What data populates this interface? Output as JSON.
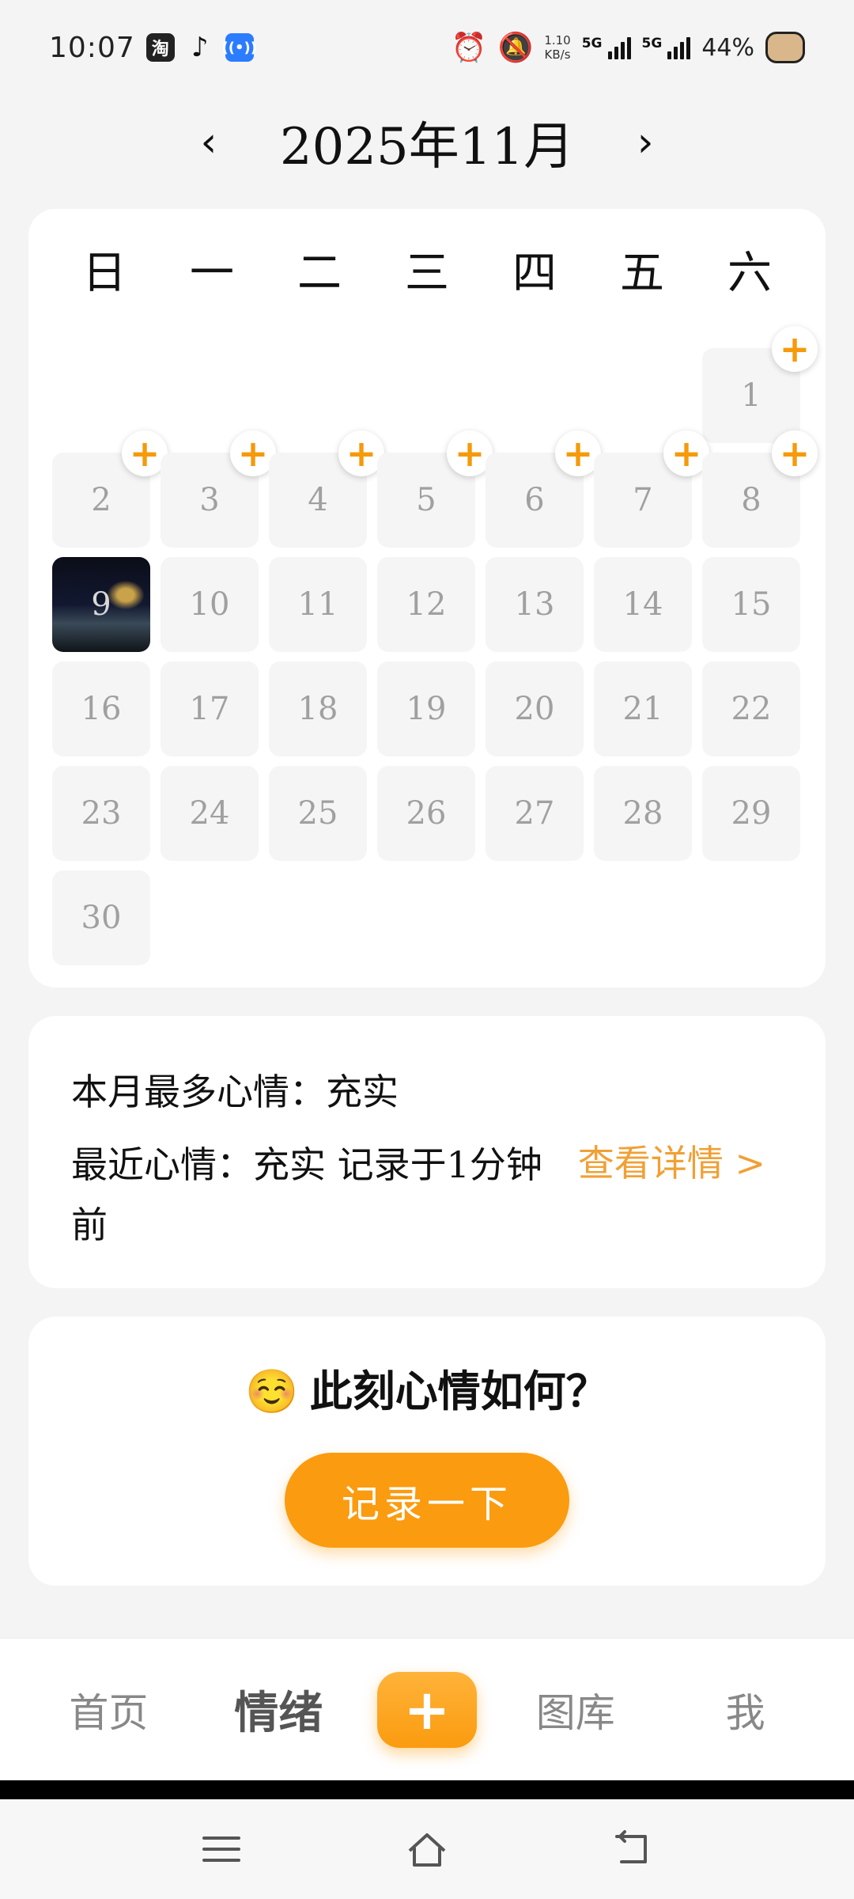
{
  "status_bar": {
    "time": "10:07",
    "app_icons": [
      "taobao-icon",
      "tiktok-icon",
      "radio-icon"
    ],
    "taobao_glyph": "淘",
    "network_speed": "1.10",
    "network_unit": "KB/s",
    "sim1": "5G",
    "sim2": "5G",
    "battery": "44%"
  },
  "calendar": {
    "month_title": "2025年11月",
    "prev_label": "‹",
    "next_label": "›",
    "weekdays": [
      "日",
      "一",
      "二",
      "三",
      "四",
      "五",
      "六"
    ],
    "leading_empty": 6,
    "days": [
      "1",
      "2",
      "3",
      "4",
      "5",
      "6",
      "7",
      "8",
      "9",
      "10",
      "11",
      "12",
      "13",
      "14",
      "15",
      "16",
      "17",
      "18",
      "19",
      "20",
      "21",
      "22",
      "23",
      "24",
      "25",
      "26",
      "27",
      "28",
      "29",
      "30"
    ],
    "add_badge_days": [
      "1",
      "2",
      "3",
      "4",
      "5",
      "6",
      "7",
      "8"
    ],
    "photo_day": "9",
    "add_symbol": "+"
  },
  "summary": {
    "most_mood": "本月最多心情：充实",
    "recent_mood": "最近心情：充实 记录于1分钟前",
    "details_link": "查看详情 >"
  },
  "mood_prompt": {
    "emoji": "☺️",
    "question": "此刻心情如何？",
    "button_label": "记录一下"
  },
  "bottom_nav": {
    "home": "首页",
    "mood": "情绪",
    "add": "+",
    "gallery": "图库",
    "me": "我"
  },
  "colors": {
    "accent": "#fb9b0f",
    "link": "#f0a035",
    "background": "#f4f4f4"
  }
}
